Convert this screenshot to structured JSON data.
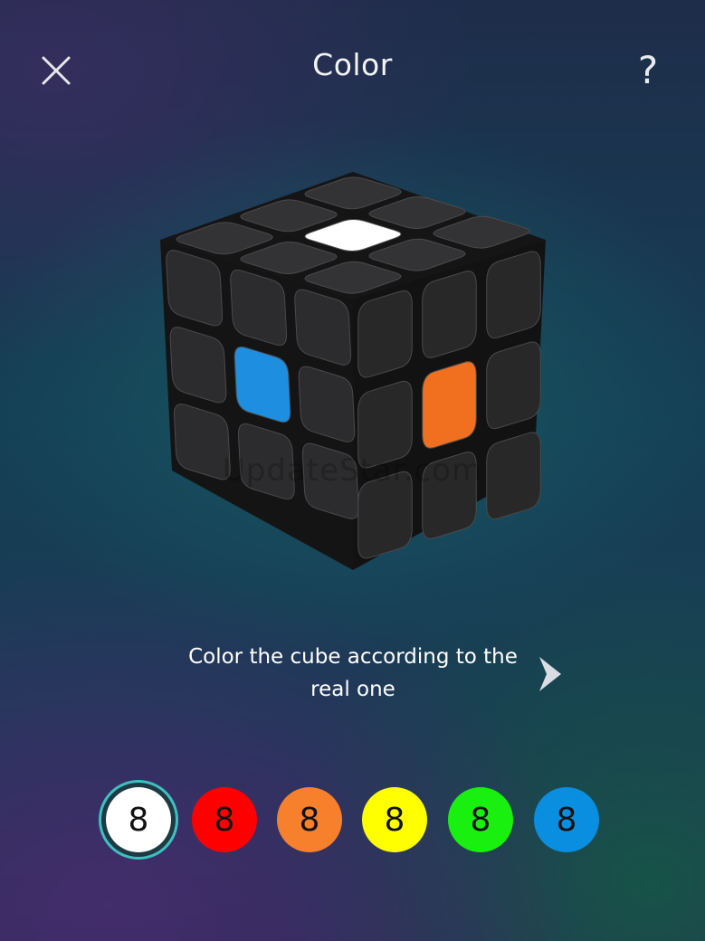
{
  "header": {
    "title": "Color",
    "close_icon": "close-icon",
    "help_label": "?"
  },
  "cube": {
    "top_center_color": "#ffffff",
    "left_center_color": "#1e8fe0",
    "right_center_color": "#f07020",
    "sticker_base_color": "#2c2c2e"
  },
  "watermark": "UpdateStar.com",
  "instruction": {
    "text": "Color the cube according to the real one",
    "next_icon": "chevron-right-icon"
  },
  "palette": {
    "swatches": [
      {
        "name": "white",
        "color": "#ffffff",
        "count": "8",
        "selected": true
      },
      {
        "name": "red",
        "color": "#ff0000",
        "count": "8",
        "selected": false
      },
      {
        "name": "orange",
        "color": "#f7802c",
        "count": "8",
        "selected": false
      },
      {
        "name": "yellow",
        "color": "#ffff00",
        "count": "8",
        "selected": false
      },
      {
        "name": "green",
        "color": "#19f00f",
        "count": "8",
        "selected": false
      },
      {
        "name": "blue",
        "color": "#0a8ee0",
        "count": "8",
        "selected": false
      }
    ]
  }
}
